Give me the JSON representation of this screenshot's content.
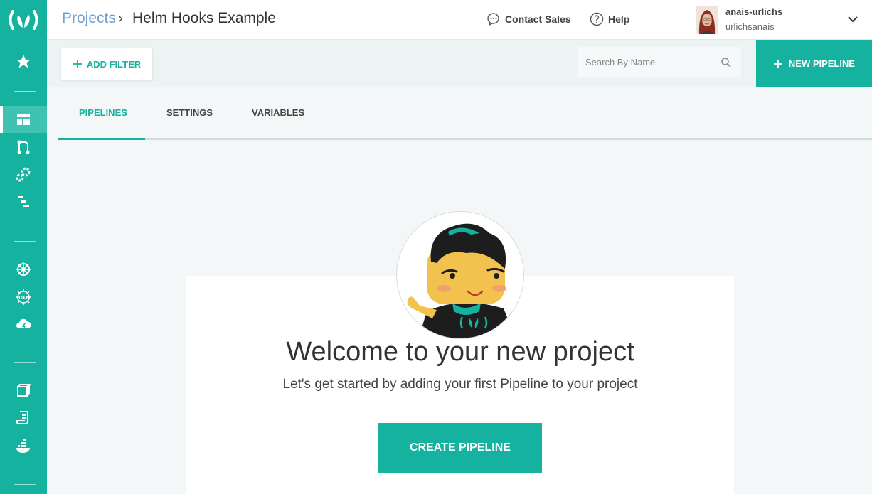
{
  "sidebar": {
    "logo": "codefresh-logo-icon",
    "items": [
      {
        "icon": "star-icon"
      },
      {
        "icon": "dashboard-icon",
        "active": true
      },
      {
        "icon": "git-branch-icon"
      },
      {
        "icon": "gears-icon"
      },
      {
        "icon": "list-tree-icon"
      },
      {
        "icon": "kubernetes-helm-wheel-icon"
      },
      {
        "icon": "helm-icon",
        "label": "HELM"
      },
      {
        "icon": "cloud-lightning-icon"
      },
      {
        "icon": "cube-icon"
      },
      {
        "icon": "scroll-icon"
      },
      {
        "icon": "docker-icon"
      }
    ]
  },
  "header": {
    "breadcrumb_root": "Projects",
    "breadcrumb_sep": "›",
    "title": "Helm Hooks Example",
    "contact_sales": "Contact Sales",
    "help": "Help",
    "user_name": "anais-urlichs",
    "user_handle": "urlichsanais"
  },
  "toolbar": {
    "add_filter": "ADD FILTER",
    "search_placeholder": "Search By Name",
    "new_pipeline": "NEW PIPELINE"
  },
  "tabs": [
    {
      "label": "PIPELINES",
      "active": true
    },
    {
      "label": "SETTINGS"
    },
    {
      "label": "VARIABLES"
    }
  ],
  "welcome": {
    "title": "Welcome to your new project",
    "subtitle": "Let's get started by adding your first Pipeline to your project",
    "cta": "CREATE PIPELINE"
  },
  "colors": {
    "accent": "#14b29f",
    "link": "#6fa0ce"
  }
}
